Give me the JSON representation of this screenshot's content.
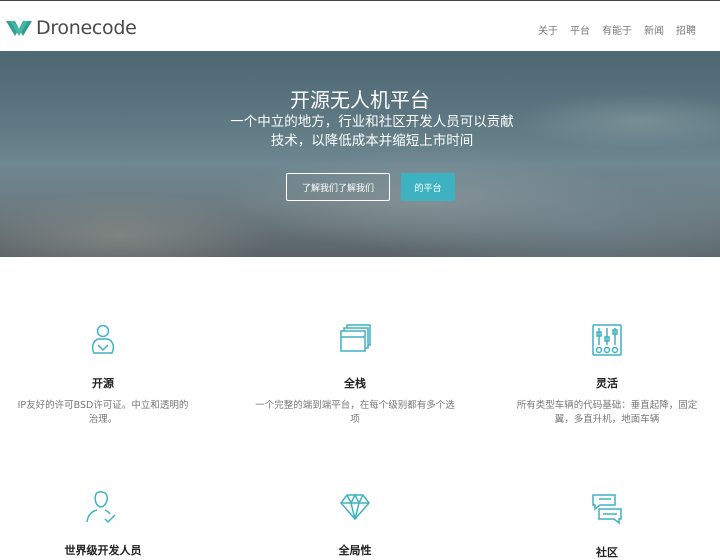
{
  "header": {
    "logo_text": "Dronecode",
    "nav": [
      "关于",
      "平台",
      "有能于",
      "新闻",
      "招聘"
    ]
  },
  "hero": {
    "title": "开源无人机平台",
    "subtitle": "一个中立的地方，行业和社区开发人员可以贡献技术，以降低成本并缩短上市时间",
    "primary_button": "了解我们了解我们",
    "secondary_button": "的平台"
  },
  "features": [
    {
      "icon": "person-icon",
      "title": "开源",
      "text": "IP友好的许可BSD许可证。中立和透明的治理。"
    },
    {
      "icon": "stack-icon",
      "title": "全栈",
      "text": "一个完整的端到端平台，在每个级别都有多个选项"
    },
    {
      "icon": "sliders-icon",
      "title": "灵活",
      "text": "所有类型车辆的代码基础：垂直起降，固定翼，多直升机，地面车辆"
    },
    {
      "icon": "user-check-icon",
      "title": "世界级开发人员",
      "text": ""
    },
    {
      "icon": "diamond-icon",
      "title": "全局性",
      "text": ""
    },
    {
      "icon": "chat-icon",
      "title": "社区",
      "text": ""
    }
  ],
  "colors": {
    "accent": "#3fb2c2",
    "logo_accent": "#3aa8a0"
  }
}
